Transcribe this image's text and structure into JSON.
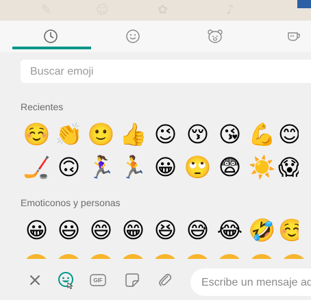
{
  "tabs": [
    {
      "icon": "clock-icon",
      "active": true
    },
    {
      "icon": "smiley-icon",
      "active": false
    },
    {
      "icon": "bear-icon",
      "active": false
    },
    {
      "icon": "cup-icon",
      "active": false
    }
  ],
  "search": {
    "placeholder": "Buscar emoji"
  },
  "sections": {
    "recent_title": "Recientes",
    "people_title": "Emoticonos y personas"
  },
  "recent_row1": [
    "☺️",
    "👏",
    "🙂",
    "👍",
    "😉",
    "😚",
    "😘",
    "💪",
    "😊"
  ],
  "recent_row2": [
    "🏒",
    "🙃",
    "🏃‍♀️",
    "🏃",
    "😀",
    "🙄",
    "😨",
    "☀️",
    "😱"
  ],
  "people_row1": [
    "😀",
    "😃",
    "😄",
    "😁",
    "😆",
    "😅",
    "😂",
    "🤣",
    "☺️"
  ],
  "composer": {
    "placeholder": "Escribe un mensaje aq",
    "gif_label": "GIF"
  },
  "colors": {
    "accent": "#009688",
    "emoji_face": "#f7b52c",
    "emoji_face_dark": "#e8912a"
  }
}
